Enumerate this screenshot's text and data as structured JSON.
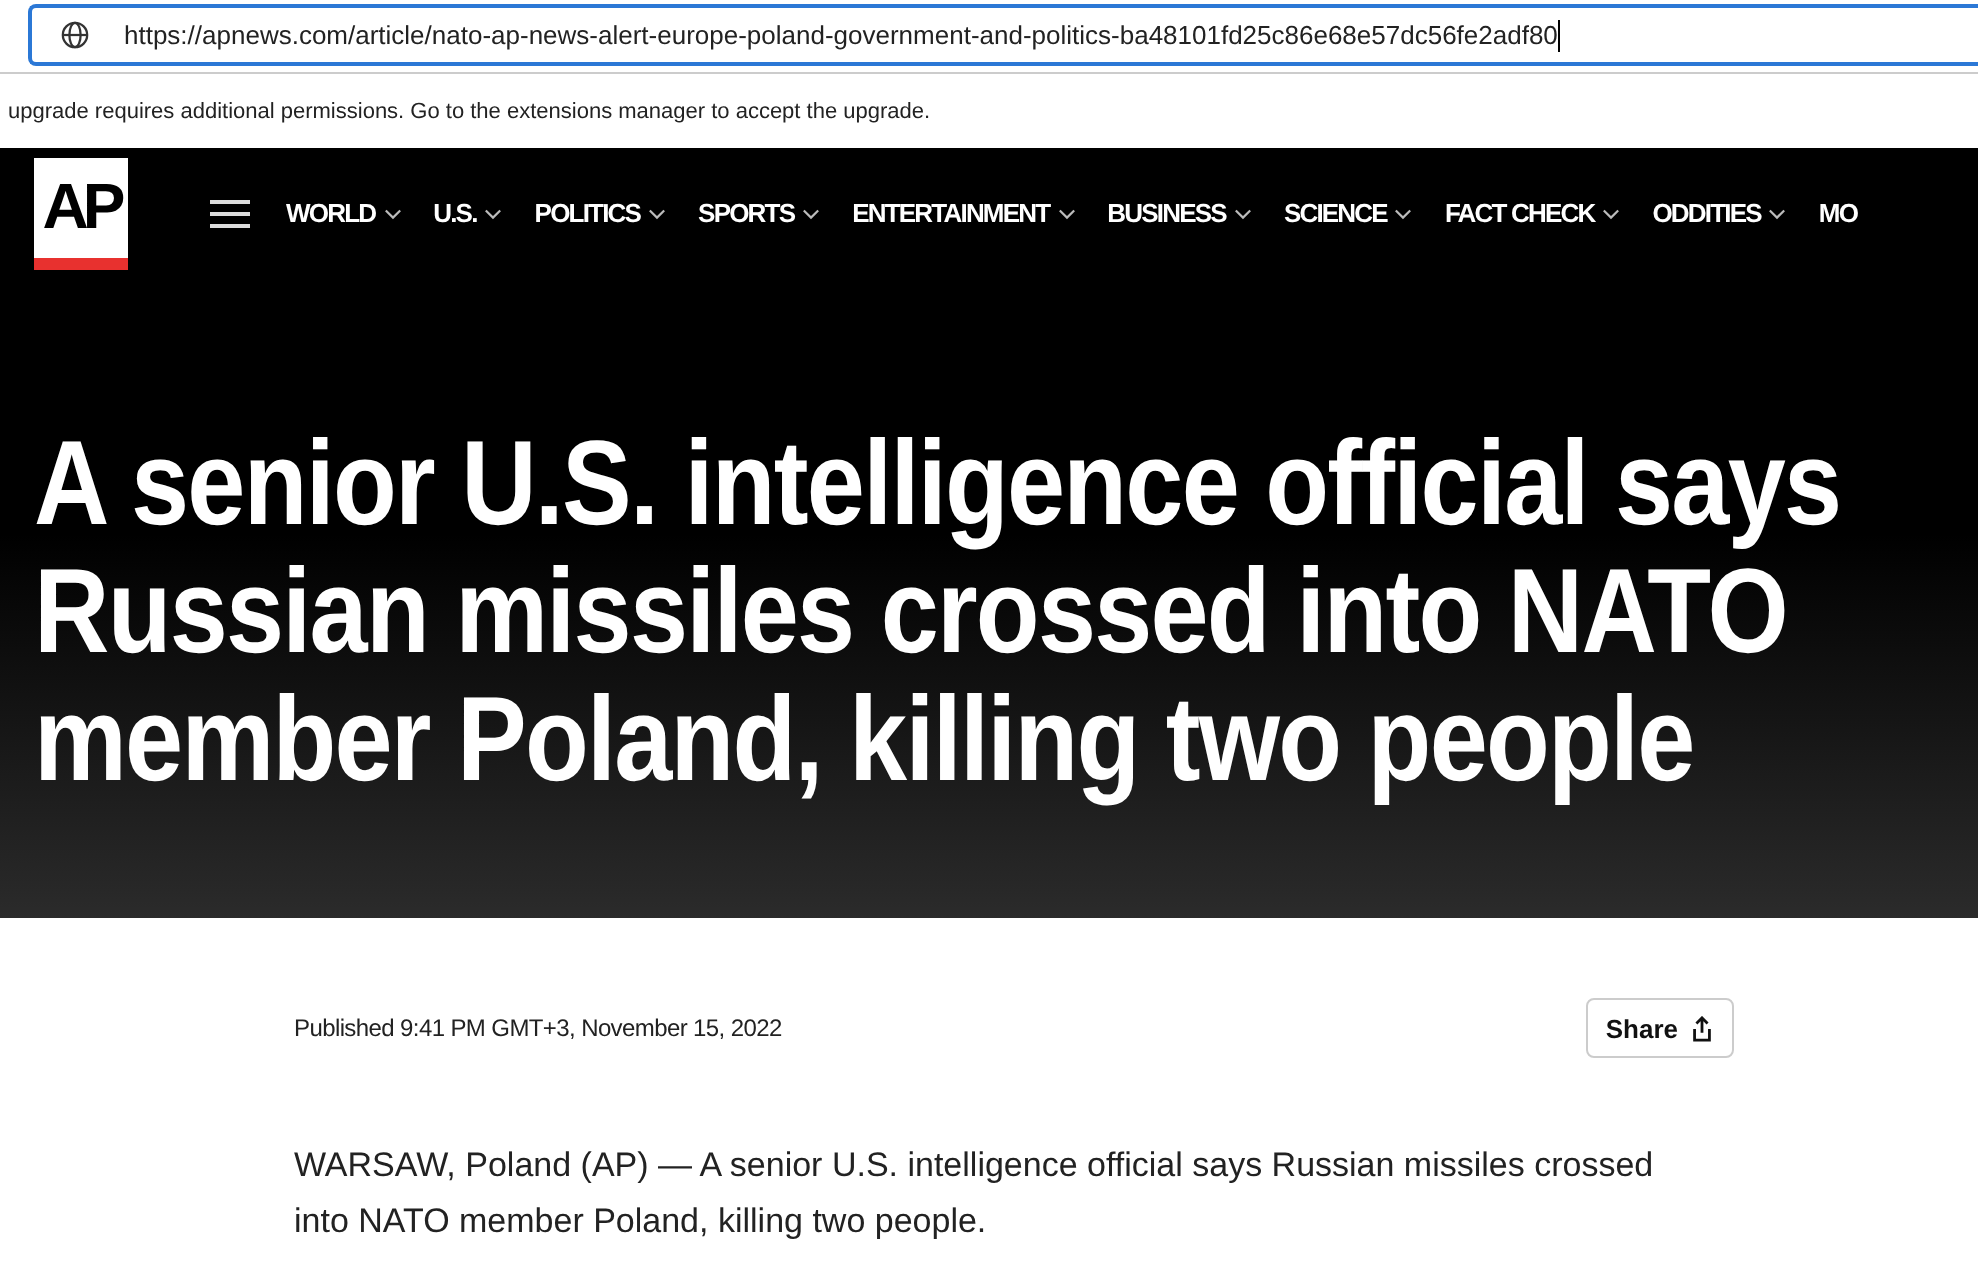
{
  "address_bar": {
    "url": "https://apnews.com/article/nato-ap-news-alert-europe-poland-government-and-politics-ba48101fd25c86e68e57dc56fe2adf80"
  },
  "notice": "upgrade requires additional permissions. Go to the extensions manager to accept the upgrade.",
  "logo": "AP",
  "nav": [
    {
      "label": "WORLD",
      "dropdown": true
    },
    {
      "label": "U.S.",
      "dropdown": true
    },
    {
      "label": "POLITICS",
      "dropdown": true
    },
    {
      "label": "SPORTS",
      "dropdown": true
    },
    {
      "label": "ENTERTAINMENT",
      "dropdown": true
    },
    {
      "label": "BUSINESS",
      "dropdown": true
    },
    {
      "label": "SCIENCE",
      "dropdown": true
    },
    {
      "label": "FACT CHECK",
      "dropdown": true
    },
    {
      "label": "ODDITIES",
      "dropdown": true
    },
    {
      "label": "MO",
      "dropdown": false
    }
  ],
  "headline": [
    "A senior U.S. intelligence official says",
    "Russian missiles crossed into NATO",
    "member Poland, killing two people"
  ],
  "published": "Published 9:41 PM GMT+3, November 15, 2022",
  "share_button": "Share",
  "body": "WARSAW, Poland (AP) — A senior U.S. intelligence official says Russian missiles crossed into NATO member Poland, killing two people."
}
